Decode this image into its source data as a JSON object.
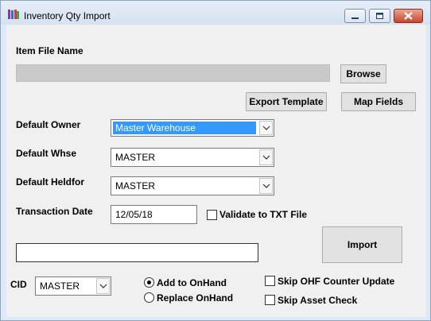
{
  "window": {
    "title": "Inventory Qty Import"
  },
  "item_file": {
    "label": "Item File Name",
    "value": "",
    "browse_label": "Browse"
  },
  "buttons": {
    "export_template": "Export Template",
    "map_fields": "Map Fields",
    "import": "Import"
  },
  "default_owner": {
    "label": "Default Owner",
    "value": "Master Warehouse"
  },
  "default_whse": {
    "label": "Default Whse",
    "value": "MASTER"
  },
  "default_heldfor": {
    "label": "Default Heldfor",
    "value": "MASTER"
  },
  "transaction_date": {
    "label": "Transaction Date",
    "value": "12/05/18"
  },
  "validate_txt": {
    "label": "Validate to TXT File",
    "checked": false
  },
  "status_field": {
    "value": ""
  },
  "cid": {
    "label": "CID",
    "value": "MASTER"
  },
  "onhand_mode": {
    "options": [
      {
        "label": "Add to OnHand",
        "selected": true
      },
      {
        "label": "Replace OnHand",
        "selected": false
      }
    ]
  },
  "options": {
    "skip_ohf": {
      "label": "Skip OHF Counter Update",
      "checked": false
    },
    "skip_asset": {
      "label": "Skip Asset Check",
      "checked": false
    }
  },
  "icons": [
    "app-icon",
    "minimize-icon",
    "maximize-icon",
    "close-icon",
    "chevron-down-icon"
  ]
}
